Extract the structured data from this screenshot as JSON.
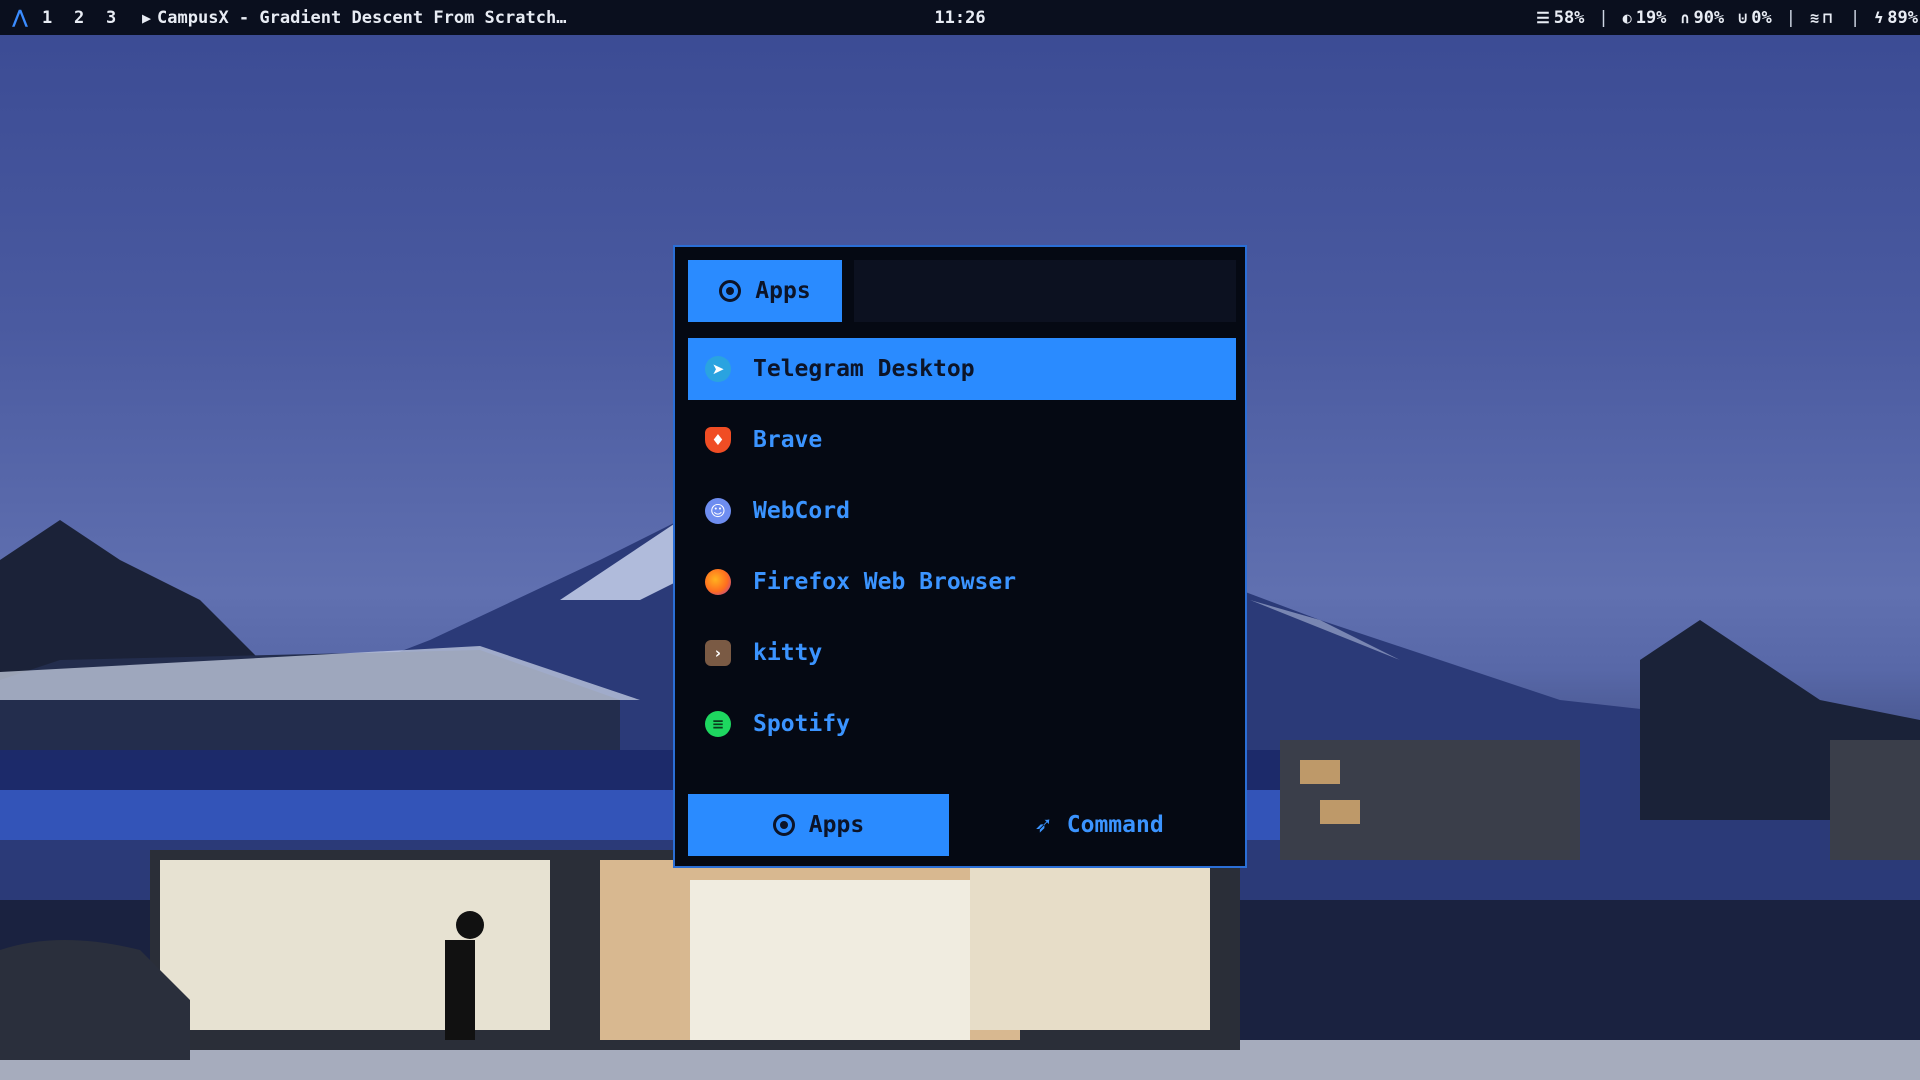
{
  "topbar": {
    "logo_icon": "arch-logo-icon",
    "workspaces": [
      "1",
      "2",
      "3"
    ],
    "window_title": "CampusX - Gradient Descent From Scratch…",
    "clock": "11:26",
    "memory": "58%",
    "brightness": "19%",
    "headphones": "90%",
    "microphone": "0%",
    "battery": "89%",
    "separator": "|"
  },
  "launcher": {
    "mode_label": "Apps",
    "search_placeholder": "",
    "items": [
      {
        "label": "Telegram Desktop",
        "icon": "telegram-icon",
        "color": "#2aa3e0"
      },
      {
        "label": "Brave",
        "icon": "brave-icon",
        "color": "#f04d24"
      },
      {
        "label": "WebCord",
        "icon": "discord-icon",
        "color": "#6e8df0"
      },
      {
        "label": "Firefox Web Browser",
        "icon": "firefox-icon",
        "color": "#ff6d1f"
      },
      {
        "label": "kitty",
        "icon": "kitty-icon",
        "color": "#7a5a44"
      },
      {
        "label": "Spotify",
        "icon": "spotify-icon",
        "color": "#1ed760"
      }
    ],
    "footer": {
      "apps_label": "Apps",
      "command_label": "Command"
    }
  },
  "colors": {
    "accent": "#2a8bff",
    "launcher_bg": "#050913",
    "topbar_bg": "#0a0f1e"
  }
}
